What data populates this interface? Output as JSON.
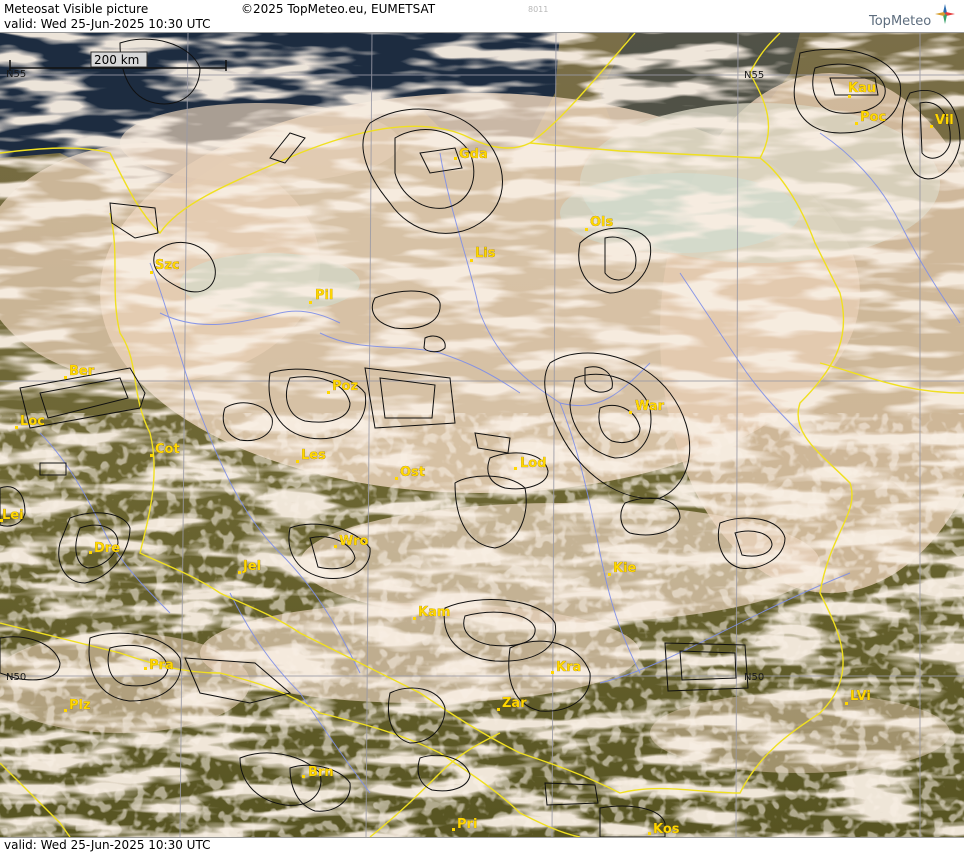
{
  "header": {
    "title": "Meteosat Visible picture",
    "valid": "valid:  Wed  25-Jun-2025  10:30 UTC",
    "copyright": "©2025 TopMeteo.eu, EUMETSAT",
    "code": "8011",
    "logo": "TopMeteo"
  },
  "footer": {
    "valid": "valid:  Wed  25-Jun-2025  10:30 UTC"
  },
  "map": {
    "scale_label": "200 km",
    "grid_labels": [
      {
        "id": "n55-left",
        "text": "N55"
      },
      {
        "id": "n55-mid",
        "text": "N55"
      },
      {
        "id": "n50-left",
        "text": "N50"
      },
      {
        "id": "n50-mid",
        "text": "N50"
      }
    ],
    "cities": [
      {
        "id": "gda",
        "name": "Gda"
      },
      {
        "id": "kau",
        "name": "Kau"
      },
      {
        "id": "poc",
        "name": "Poc"
      },
      {
        "id": "vil",
        "name": "Vil"
      },
      {
        "id": "ols",
        "name": "Ols"
      },
      {
        "id": "lis",
        "name": "Lis"
      },
      {
        "id": "szc",
        "name": "Szc"
      },
      {
        "id": "pil",
        "name": "Pil"
      },
      {
        "id": "ber",
        "name": "Ber"
      },
      {
        "id": "poz",
        "name": "Poz"
      },
      {
        "id": "loc",
        "name": "Loc"
      },
      {
        "id": "war",
        "name": "War"
      },
      {
        "id": "cot",
        "name": "Cot"
      },
      {
        "id": "les",
        "name": "Les"
      },
      {
        "id": "ost",
        "name": "Ost"
      },
      {
        "id": "lod",
        "name": "Lod"
      },
      {
        "id": "lei",
        "name": "Lei"
      },
      {
        "id": "wro",
        "name": "Wro"
      },
      {
        "id": "dre",
        "name": "Dre"
      },
      {
        "id": "jel",
        "name": "Jel"
      },
      {
        "id": "kie",
        "name": "Kie"
      },
      {
        "id": "kam",
        "name": "Kam"
      },
      {
        "id": "pra",
        "name": "Pra"
      },
      {
        "id": "kra",
        "name": "Kra"
      },
      {
        "id": "lvi",
        "name": "LVi"
      },
      {
        "id": "plz",
        "name": "Plz"
      },
      {
        "id": "zar",
        "name": "Zar"
      },
      {
        "id": "brn",
        "name": "Brn"
      },
      {
        "id": "pri",
        "name": "Pri"
      },
      {
        "id": "kos",
        "name": "Kos"
      }
    ],
    "colors": {
      "border": "#f0e020",
      "river": "#7f8fe8",
      "grid": "#9a9aa0",
      "contour": "#101010",
      "city": "#ffd700",
      "sea": "#1b2a3f",
      "land": "#5f5a2a",
      "cloud": "#efd6be"
    }
  }
}
